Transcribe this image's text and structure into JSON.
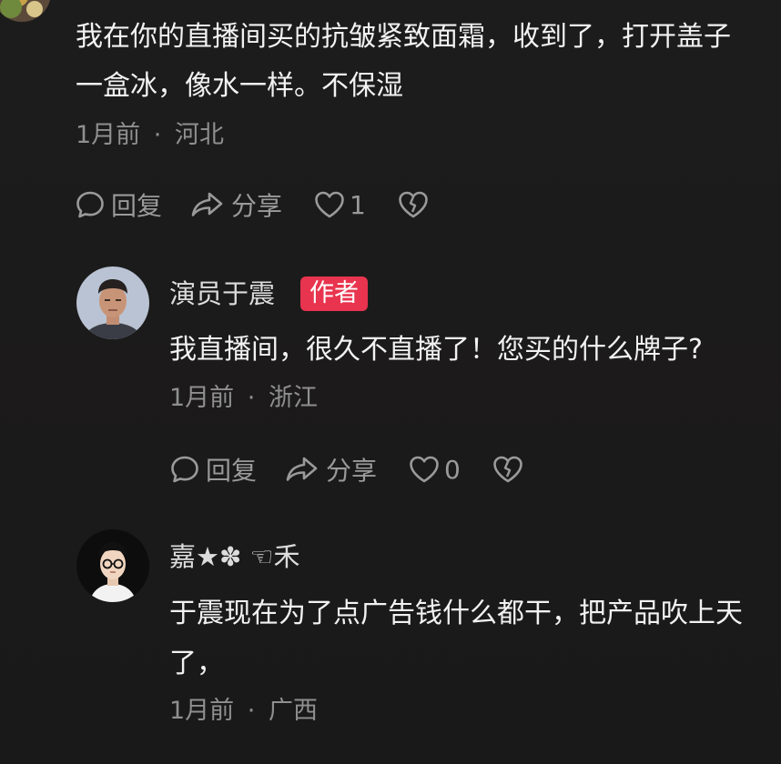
{
  "comments": [
    {
      "text_line1": "我在你的直播间买的抗皱紧致面霜，收到了，打开盖子",
      "text_line2": "一盒冰，像水一样。不保湿",
      "time": "1月前",
      "location": "河北",
      "reply_label": "回复",
      "share_label": "分享",
      "like_count": "1"
    },
    {
      "username": "演员于震",
      "badge": "作者",
      "text_line1": "我直播间，很久不直播了！您买的什么牌子?",
      "time": "1月前",
      "location": "浙江",
      "reply_label": "回复",
      "share_label": "分享",
      "like_count": "0"
    },
    {
      "username": "嘉★✽ ☜禾",
      "text_line1": "于震现在为了点广告钱什么都干，把产品吹上天",
      "text_line2": "了，",
      "time": "1月前",
      "location": "广西"
    }
  ],
  "meta_separator": "·",
  "icons": {
    "reply": "chat-bubble-icon",
    "share": "share-arrow-icon",
    "like": "heart-icon",
    "dislike": "broken-heart-icon"
  },
  "colors": {
    "background": "#1b1a1a",
    "text": "#f2f2f2",
    "muted": "#8f8f8f",
    "badge": "#e8344e"
  }
}
